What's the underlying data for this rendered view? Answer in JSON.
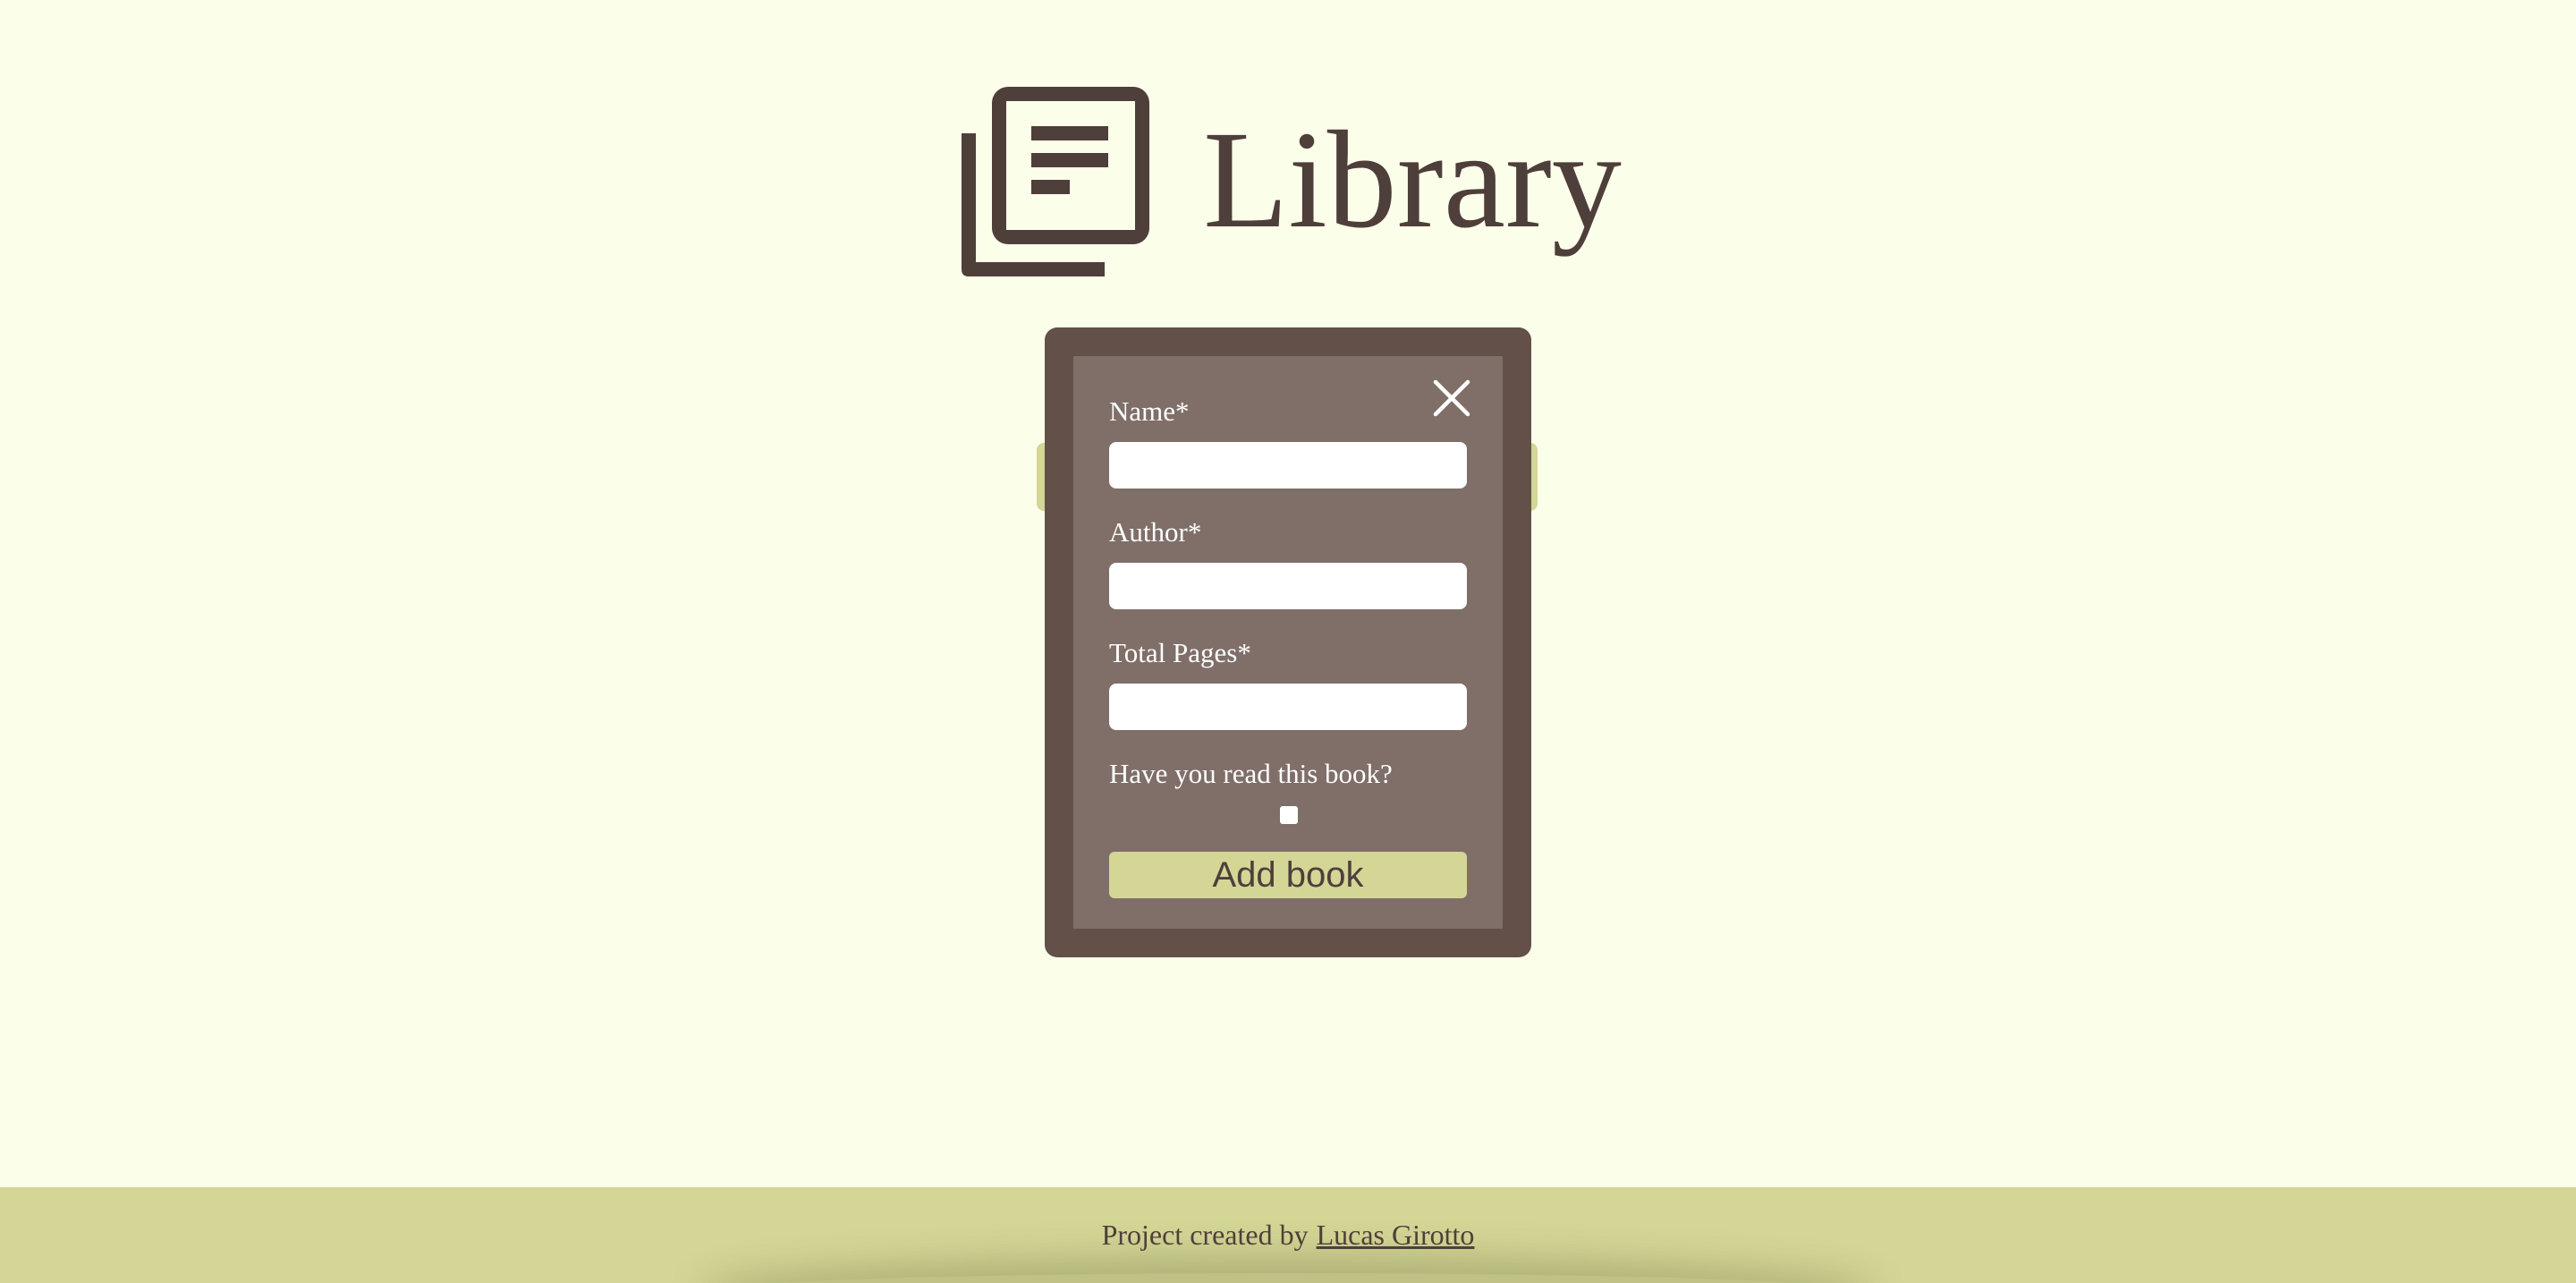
{
  "header": {
    "logo_icon": "library-books-icon",
    "title": "Library"
  },
  "modal": {
    "close_icon": "close-icon",
    "fields": [
      {
        "label": "Name*",
        "value": "",
        "placeholder": ""
      },
      {
        "label": "Author*",
        "value": "",
        "placeholder": ""
      },
      {
        "label": "Total Pages*",
        "value": "",
        "placeholder": ""
      }
    ],
    "read_question": "Have you read this book?",
    "read_checked": false,
    "submit_label": "Add book"
  },
  "footer": {
    "prefix": "Project created by",
    "author_link": "Lucas Girotto"
  },
  "colors": {
    "background": "#fbffea",
    "accent": "#d3d695",
    "dark_brown": "#4f3f3b",
    "modal_outer": "#625049",
    "modal_inner": "#7f6f68"
  }
}
